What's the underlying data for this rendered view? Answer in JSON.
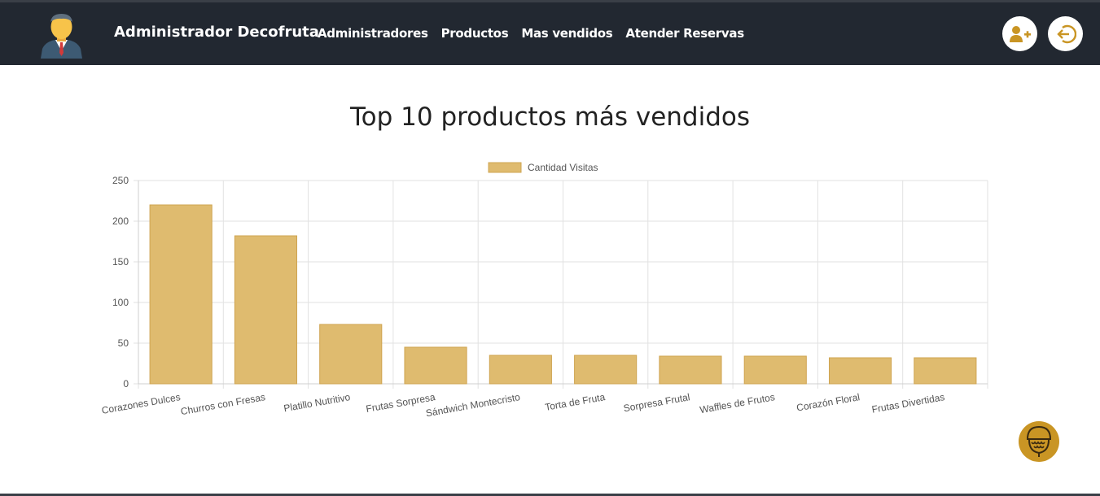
{
  "header": {
    "brand": "Administrador Decofruta",
    "nav": [
      {
        "label": "Administradores"
      },
      {
        "label": "Productos"
      },
      {
        "label": "Mas vendidos"
      },
      {
        "label": "Atender Reservas"
      }
    ],
    "icons": {
      "add_user": "user-plus-icon",
      "logout": "sign-out-icon",
      "avatar": "businessman-avatar-icon"
    }
  },
  "main": {
    "title": "Top 10 productos más vendidos"
  },
  "colors": {
    "navbar": "#222831",
    "accent": "#c99524",
    "bar_fill": "#dfbb6f",
    "bar_stroke": "#cfa451"
  },
  "chart_data": {
    "type": "bar",
    "categories": [
      "Corazones Dulces",
      "Churros con Fresas",
      "Platillo Nutritivo",
      "Frutas Sorpresa",
      "Sándwich Montecristo",
      "Torta de Fruta",
      "Sorpresa Frutal",
      "Waffles de Frutos",
      "Corazón Floral",
      "Frutas Divertidas"
    ],
    "series": [
      {
        "name": "Cantidad Visitas",
        "values": [
          220,
          182,
          73,
          45,
          35,
          35,
          34,
          34,
          32,
          32
        ]
      }
    ],
    "ylim": [
      0,
      250
    ],
    "yticks": [
      0,
      50,
      100,
      150,
      200,
      250
    ],
    "grid": true,
    "legend": "top-center"
  }
}
